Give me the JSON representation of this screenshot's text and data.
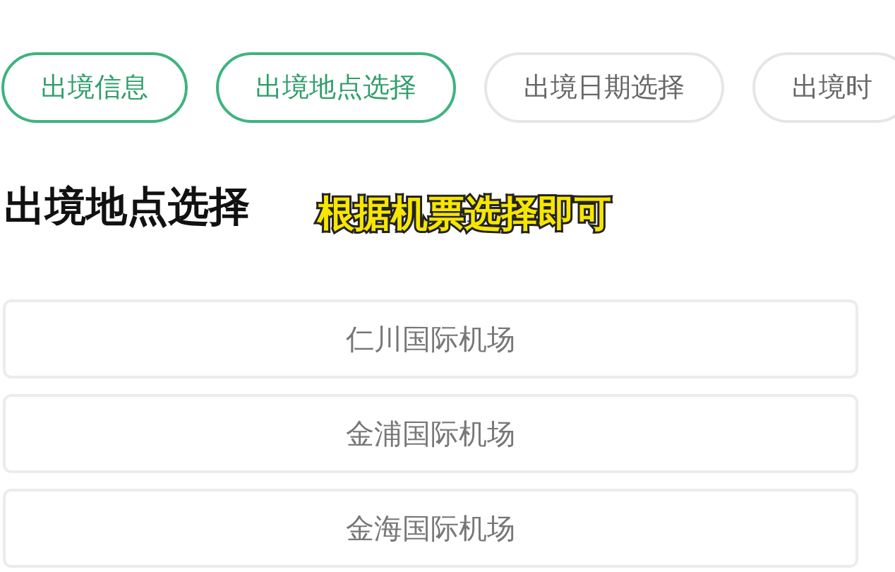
{
  "tabs": [
    {
      "label": "出境信息",
      "selected": true
    },
    {
      "label": "出境地点选择",
      "selected": true
    },
    {
      "label": "出境日期选择",
      "selected": false
    },
    {
      "label": "出境时",
      "selected": false
    }
  ],
  "heading": "出境地点选择",
  "annotation": "根据机票选择即可",
  "options": [
    {
      "label": "仁川国际机场"
    },
    {
      "label": "金浦国际机场"
    },
    {
      "label": "金海国际机场"
    }
  ]
}
